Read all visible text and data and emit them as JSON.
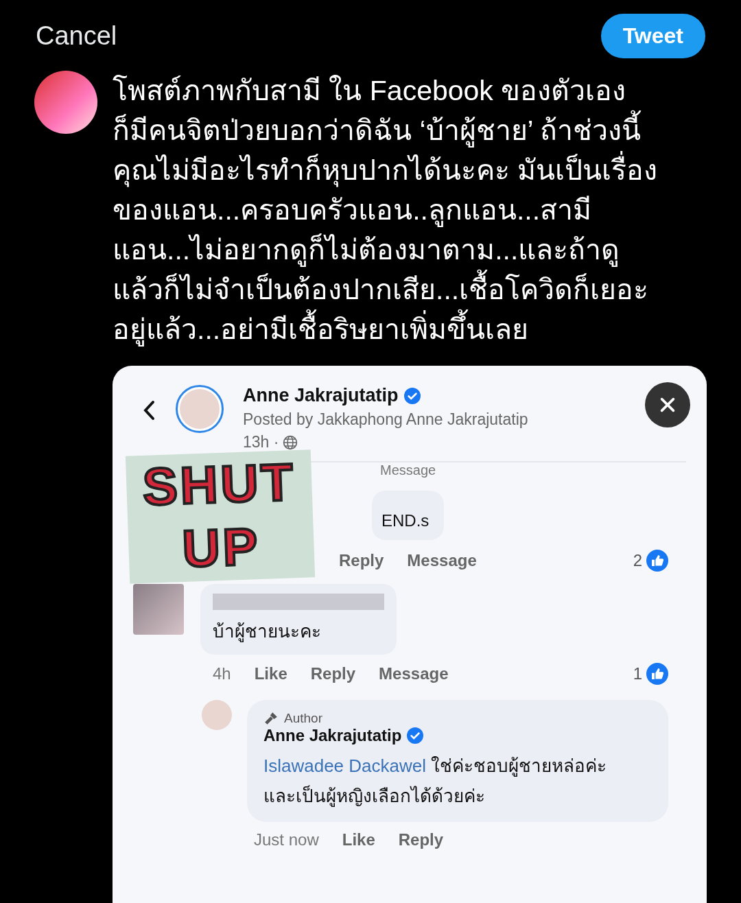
{
  "header": {
    "cancel": "Cancel",
    "tweet_button": "Tweet"
  },
  "tweet": {
    "text": "โพสต์ภาพกับสามี ใน Facebook ของตัวเอง\nก็มีคนจิตป่วยบอกว่าดิฉัน ‘บ้าผู้ชาย’ ถ้าช่วงนี้\nคุณไม่มีอะไรทำก็หุบปากได้นะคะ มันเป็นเรื่อง\nของแอน...ครอบครัวแอน..ลูกแอน...สามี\nแอน...ไม่อยากดูก็ไม่ต้องมาตาม...และถ้าดู\nแล้วก็ไม่จำเป็นต้องปากเสีย...เชื้อโควิดก็เยอะ\nอยู่แล้ว...อย่ามีเชื้อริษยาเพิ่มขึ้นเลย"
  },
  "attachment": {
    "post": {
      "author": "Anne Jakrajutatip",
      "verified": true,
      "posted_by": "Posted by Jakkaphong Anne Jakrajutatip",
      "time": "13h ·"
    },
    "sticker": [
      "SHUT",
      "UP"
    ],
    "comments": [
      {
        "kind": "covered",
        "cut_action": "Message",
        "bubble_text": "END.s",
        "actions": [
          "Reply",
          "Message"
        ],
        "reaction_count": "2"
      },
      {
        "kind": "comment",
        "text": "บ้าผู้ชายนะคะ",
        "time": "4h",
        "actions": [
          "Like",
          "Reply",
          "Message"
        ],
        "reaction_count": "1",
        "replies": [
          {
            "badge": "Author",
            "author": "Anne Jakrajutatip",
            "verified": true,
            "mention": "Islawadee Dackawel",
            "text": "ใช่ค่ะชอบผู้ชายหล่อค่ะ\nและเป็นผู้หญิงเลือกได้ด้วยค่ะ",
            "time": "Just now",
            "actions": [
              "Like",
              "Reply"
            ]
          }
        ]
      }
    ]
  }
}
